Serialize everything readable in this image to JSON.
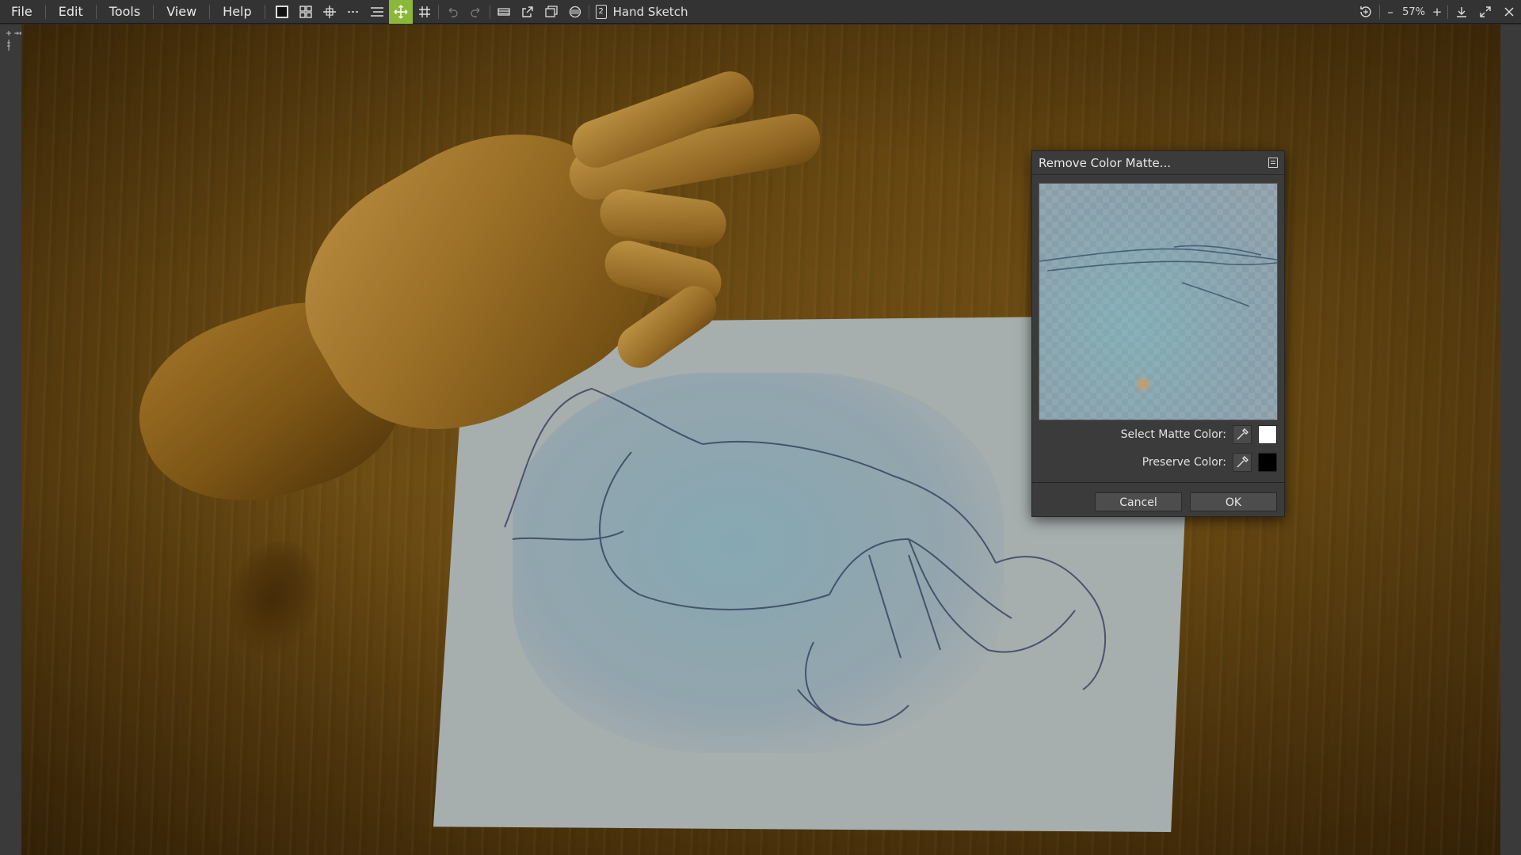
{
  "menu": {
    "items": [
      "File",
      "Edit",
      "Tools",
      "View",
      "Help"
    ]
  },
  "document": {
    "page_number": "2",
    "title": "Hand Sketch"
  },
  "zoom": {
    "value": "57%",
    "minus": "–",
    "plus": "+"
  },
  "dialog": {
    "title": "Remove Color Matte...",
    "select_matte_label": "Select Matte Color:",
    "preserve_label": "Preserve Color:",
    "matte_color": "#ffffff",
    "preserve_color": "#000000",
    "cancel_label": "Cancel",
    "ok_label": "OK"
  },
  "colors": {
    "accent": "#8bb83a",
    "toolbar_bg": "#333333",
    "dialog_bg": "#3b3b3b"
  }
}
